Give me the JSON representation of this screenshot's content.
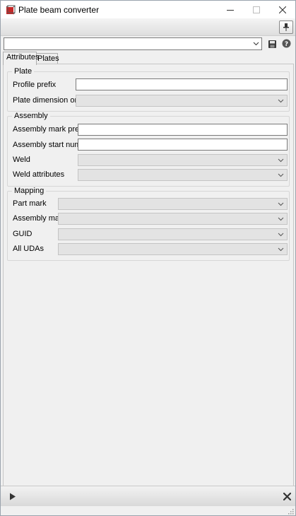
{
  "window": {
    "title": "Plate beam converter",
    "icon": "plate-beam-app-icon",
    "controls": {
      "minimize": "minimize-icon",
      "maximize": "maximize-icon",
      "close": "close-icon"
    }
  },
  "toolbar": {
    "pin_icon": "pin-icon"
  },
  "preset": {
    "value": "",
    "save_icon": "save-icon",
    "help_icon": "help-icon"
  },
  "tabs": [
    {
      "label": "Attributes",
      "active": true
    },
    {
      "label": "Plates",
      "active": false
    }
  ],
  "groups": {
    "plate": {
      "title": "Plate",
      "profile_prefix": {
        "label": "Profile prefix",
        "value": ""
      },
      "plate_dimension_order": {
        "label": "Plate dimension order",
        "value": ""
      }
    },
    "assembly": {
      "title": "Assembly",
      "assembly_mark_prefix": {
        "label": "Assembly mark prefix",
        "value": ""
      },
      "assembly_start_number": {
        "label": "Assembly start number",
        "value": ""
      },
      "weld": {
        "label": "Weld",
        "value": ""
      },
      "weld_attributes": {
        "label": "Weld attributes",
        "value": ""
      }
    },
    "mapping": {
      "title": "Mapping",
      "part_mark": {
        "label": "Part mark",
        "value": ""
      },
      "assembly_mark": {
        "label": "Assembly mark",
        "value": ""
      },
      "guid": {
        "label": "GUID",
        "value": ""
      },
      "all_udas": {
        "label": "All UDAs",
        "value": ""
      }
    }
  },
  "bottom": {
    "run_icon": "play-icon",
    "cancel_icon": "cancel-x-icon"
  },
  "colors": {
    "window_bg": "#f0f0f0",
    "border": "#7a7a7a",
    "disabled_field": "#e3e3e3"
  }
}
